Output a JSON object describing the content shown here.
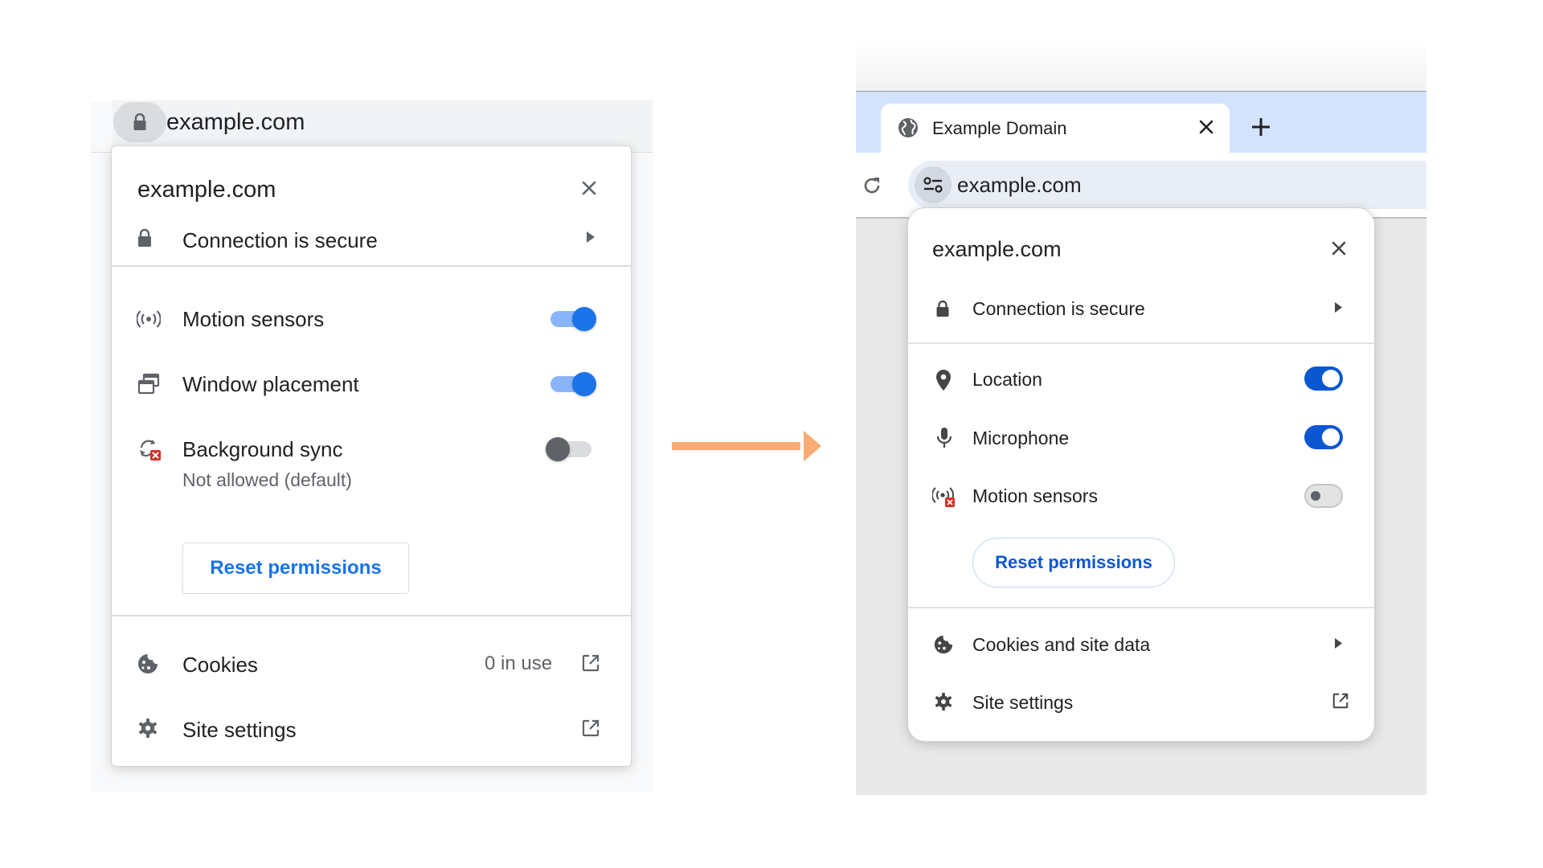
{
  "old_ui": {
    "url": "example.com",
    "bubble": {
      "title": "example.com",
      "connection_label": "Connection is secure",
      "permissions": [
        {
          "label": "Motion sensors",
          "icon": "motion-sensors-icon",
          "enabled": true
        },
        {
          "label": "Window placement",
          "icon": "window-placement-icon",
          "enabled": true
        },
        {
          "label": "Background sync",
          "icon": "background-sync-blocked-icon",
          "enabled": false,
          "status": "Not allowed (default)"
        }
      ],
      "reset_label": "Reset permissions",
      "cookies": {
        "label": "Cookies",
        "value": "0 in use"
      },
      "site_settings_label": "Site settings"
    }
  },
  "new_ui": {
    "tab": {
      "title": "Example Domain"
    },
    "url": "example.com",
    "bubble": {
      "title": "example.com",
      "connection_label": "Connection is secure",
      "permissions": [
        {
          "label": "Location",
          "icon": "location-pin-icon",
          "enabled": true
        },
        {
          "label": "Microphone",
          "icon": "microphone-icon",
          "enabled": true
        },
        {
          "label": "Motion sensors",
          "icon": "motion-sensors-blocked-icon",
          "enabled": false
        }
      ],
      "reset_label": "Reset permissions",
      "cookies_label": "Cookies and site data",
      "site_settings_label": "Site settings"
    }
  },
  "colors": {
    "accent_old": "#1a73e8",
    "accent_new": "#0b57d0",
    "arrow": "#f9ab73",
    "tabstrip": "#d3e3fd"
  }
}
